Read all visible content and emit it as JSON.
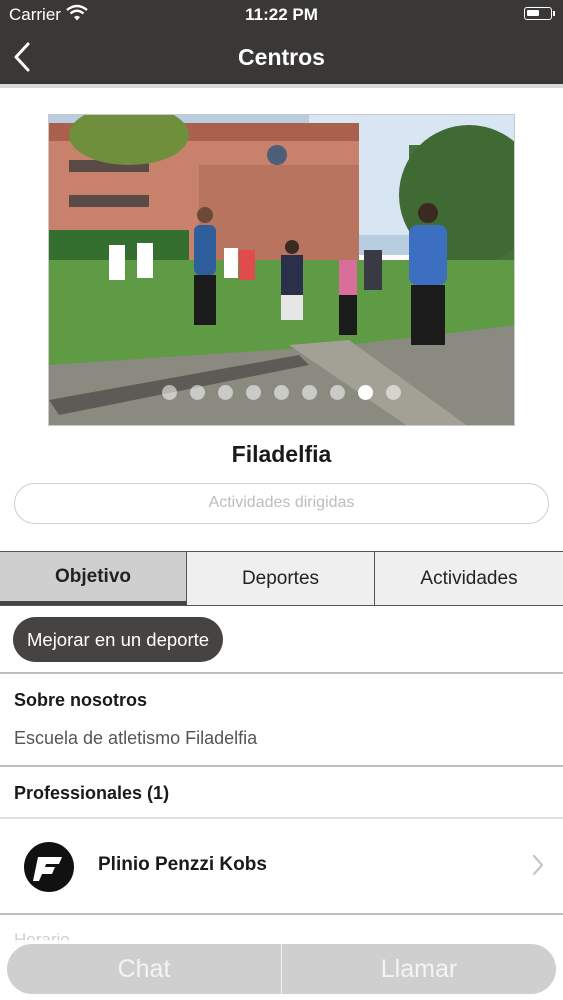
{
  "status_bar": {
    "carrier": "Carrier",
    "time": "11:22 PM"
  },
  "nav": {
    "title": "Centros",
    "back_icon": "chevron-left-icon"
  },
  "carousel": {
    "dot_count": 9,
    "active_index": 7
  },
  "center": {
    "name": "Filadelfia",
    "activities_button": "Actividades dirigidas"
  },
  "tabs": [
    {
      "label": "Objetivo",
      "selected": true
    },
    {
      "label": "Deportes",
      "selected": false
    },
    {
      "label": "Actividades",
      "selected": false
    }
  ],
  "goal_chip": "Mejorar en un deporte",
  "about": {
    "heading": "Sobre nosotros",
    "text": "Escuela de atletismo Filadelfia"
  },
  "professionals": {
    "heading": "Professionales (1)",
    "items": [
      {
        "name": "Plinio Penzzi Kobs",
        "avatar_icon": "logo-avatar-icon"
      }
    ]
  },
  "next_section_label": "Horario",
  "actions": {
    "chat": "Chat",
    "call": "Llamar"
  },
  "colors": {
    "header": "#3a3837",
    "chip": "#454443",
    "action_bar": "#cfcfcf"
  }
}
